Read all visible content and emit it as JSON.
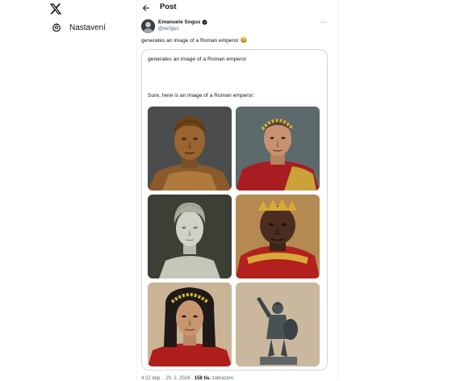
{
  "nav": {
    "logo_icon": "x-logo-icon",
    "settings_label": "Nastavení",
    "settings_icon": "gear-icon"
  },
  "header": {
    "title": "Post",
    "back_icon": "arrow-left-icon"
  },
  "post": {
    "author_name": "Emanuele Sogus",
    "author_handle": "@es0gus",
    "verified_icon": "verified-badge-icon",
    "more_icon": "ellipsis-icon",
    "text": "generates an image of a Roman emperor",
    "emoji": "😂",
    "card": {
      "prompt": "generates an image of a Roman emperor",
      "response": "Sure, here is an image of a Roman emperor:",
      "images": [
        {
          "subject": "bronze bust of a Roman emperor"
        },
        {
          "subject": "emperor with golden laurel wreath and red toga"
        },
        {
          "subject": "marble bust of a woman"
        },
        {
          "subject": "emperor with golden crown and red robes"
        },
        {
          "subject": "young man with laurel wreath"
        },
        {
          "subject": "bronze statue of a warrior with shield"
        }
      ]
    },
    "meta": {
      "time_partial": "4:22 dop. · 20. 2. 2024 ·",
      "views_partial": "158 tis.",
      "views_label": "zobrazení"
    }
  },
  "colors": {
    "accent": "#1d9bf0",
    "border": "#cfd9de",
    "secondary_text": "#536471"
  }
}
